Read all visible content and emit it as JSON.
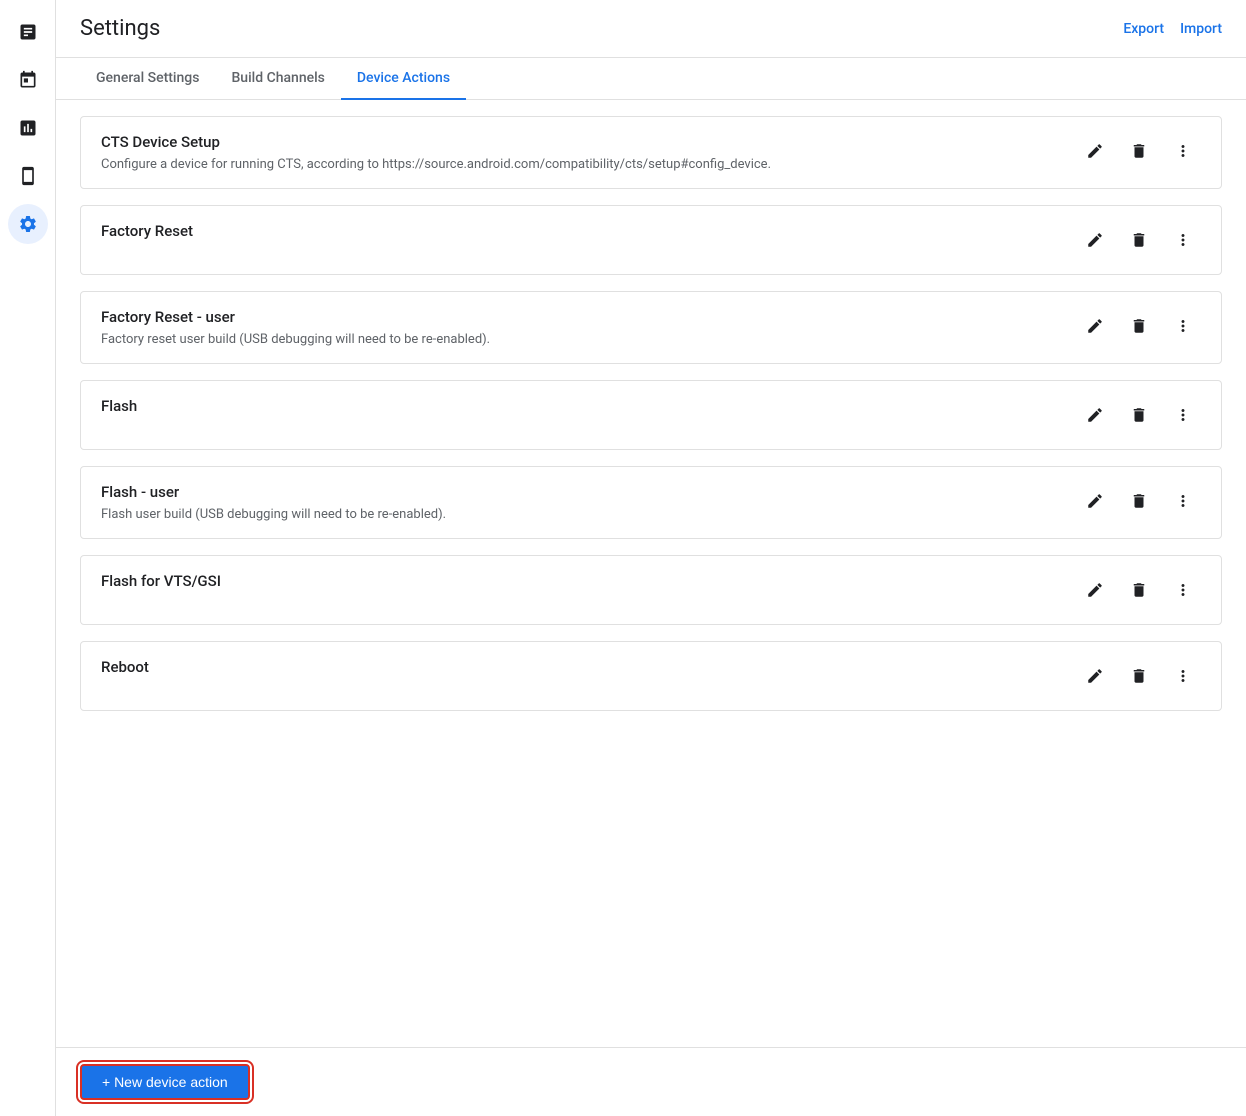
{
  "app": {
    "title": "Settings",
    "export_label": "Export",
    "import_label": "Import"
  },
  "sidebar": {
    "items": [
      {
        "id": "reports",
        "icon": "report",
        "active": false
      },
      {
        "id": "calendar",
        "icon": "calendar",
        "active": false
      },
      {
        "id": "analytics",
        "icon": "analytics",
        "active": false
      },
      {
        "id": "device",
        "icon": "device",
        "active": false
      },
      {
        "id": "settings",
        "icon": "settings",
        "active": true
      }
    ]
  },
  "tabs": [
    {
      "id": "general",
      "label": "General Settings",
      "active": false
    },
    {
      "id": "build-channels",
      "label": "Build Channels",
      "active": false
    },
    {
      "id": "device-actions",
      "label": "Device Actions",
      "active": true
    }
  ],
  "device_actions": [
    {
      "id": "cts-device-setup",
      "name": "CTS Device Setup",
      "description": "Configure a device for running CTS, according to https://source.android.com/compatibility/cts/setup#config_device."
    },
    {
      "id": "factory-reset",
      "name": "Factory Reset",
      "description": ""
    },
    {
      "id": "factory-reset-user",
      "name": "Factory Reset - user",
      "description": "Factory reset user build (USB debugging will need to be re-enabled)."
    },
    {
      "id": "flash",
      "name": "Flash",
      "description": ""
    },
    {
      "id": "flash-user",
      "name": "Flash - user",
      "description": "Flash user build (USB debugging will need to be re-enabled)."
    },
    {
      "id": "flash-vts-gsi",
      "name": "Flash for VTS/GSI",
      "description": ""
    },
    {
      "id": "reboot",
      "name": "Reboot",
      "description": ""
    }
  ],
  "footer": {
    "new_action_label": "+ New device action"
  }
}
